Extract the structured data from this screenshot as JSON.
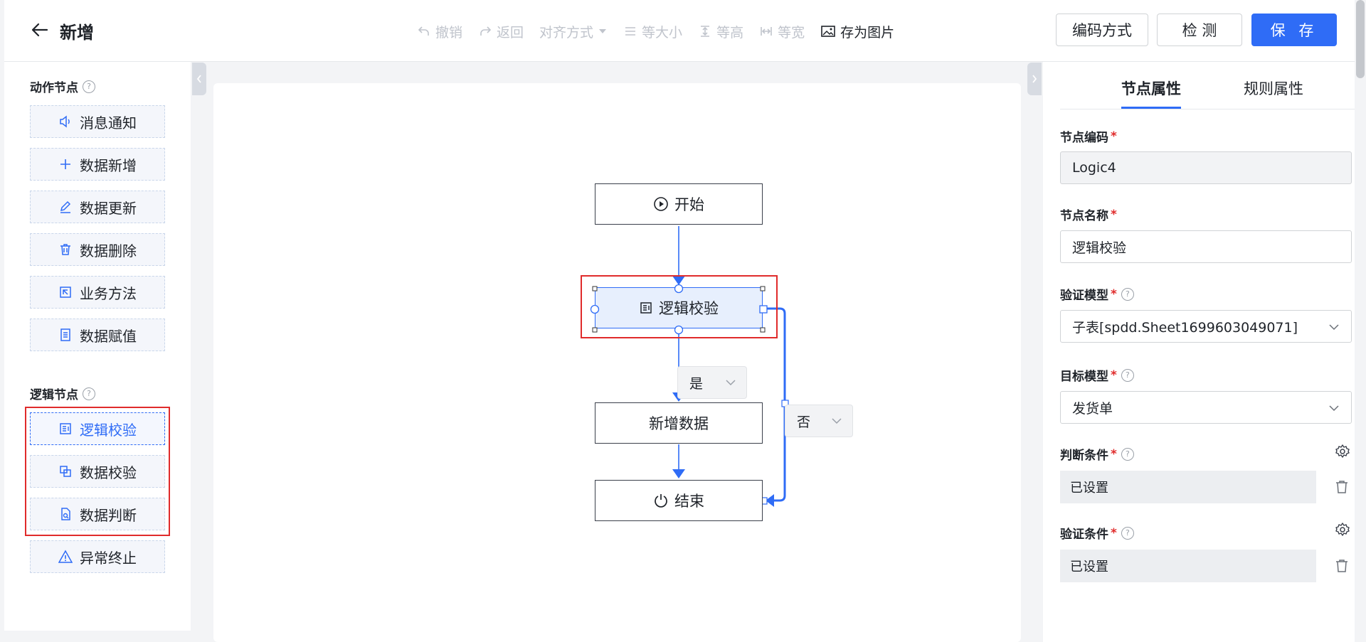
{
  "header": {
    "title": "新增",
    "toolbar": {
      "undo": "撤销",
      "redo": "返回",
      "align": "对齐方式",
      "same_size": "等大小",
      "same_height": "等高",
      "same_width": "等宽",
      "save_image": "存为图片"
    },
    "buttons": {
      "encoding": "编码方式",
      "check": "检 测",
      "save": "保 存"
    }
  },
  "left_panel": {
    "action_section": "动作节点",
    "action_items": [
      "消息通知",
      "数据新增",
      "数据更新",
      "数据删除",
      "业务方法",
      "数据赋值"
    ],
    "logic_section": "逻辑节点",
    "logic_items": [
      "逻辑校验",
      "数据校验",
      "数据判断",
      "异常终止"
    ]
  },
  "canvas": {
    "nodes": {
      "start": "开始",
      "logic": "逻辑校验",
      "add": "新增数据",
      "end": "结束"
    },
    "conditions": {
      "yes": "是",
      "no": "否"
    }
  },
  "right_panel": {
    "tabs": [
      "节点属性",
      "规则属性"
    ],
    "fields": {
      "node_code_label": "节点编码",
      "node_code_value": "Logic4",
      "node_name_label": "节点名称",
      "node_name_value": "逻辑校验",
      "validate_model_label": "验证模型",
      "validate_model_value": "子表[spdd.Sheet1699603049071]",
      "target_model_label": "目标模型",
      "target_model_value": "发货单",
      "judge_cond_label": "判断条件",
      "judge_cond_value": "已设置",
      "verify_cond_label": "验证条件",
      "verify_cond_value": "已设置"
    }
  },
  "colors": {
    "accent": "#2f6cf6",
    "highlight": "#e02b2b"
  }
}
